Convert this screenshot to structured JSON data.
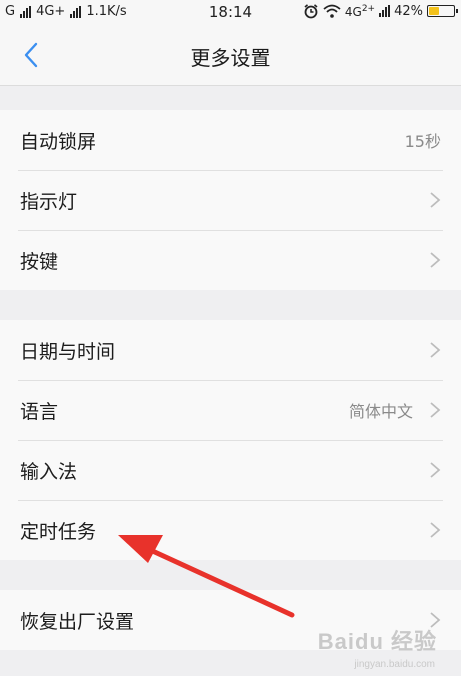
{
  "status_bar": {
    "carrier": "G",
    "network": "4G+",
    "speed": "1.1K/s",
    "time": "18:14",
    "network_right": "4G",
    "battery_percent": "42%",
    "battery_level": 0.42
  },
  "header": {
    "title": "更多设置",
    "back_icon": "chevron-left-icon"
  },
  "groups": [
    {
      "items": [
        {
          "label": "自动锁屏",
          "value": "15秒",
          "chevron": false
        },
        {
          "label": "指示灯",
          "value": "",
          "chevron": true
        },
        {
          "label": "按键",
          "value": "",
          "chevron": true
        }
      ]
    },
    {
      "items": [
        {
          "label": "日期与时间",
          "value": "",
          "chevron": true
        },
        {
          "label": "语言",
          "value": "简体中文",
          "chevron": true
        },
        {
          "label": "输入法",
          "value": "",
          "chevron": true
        },
        {
          "label": "定时任务",
          "value": "",
          "chevron": true
        }
      ]
    },
    {
      "items": [
        {
          "label": "恢复出厂设置",
          "value": "",
          "chevron": true
        }
      ]
    }
  ],
  "colors": {
    "accent": "#3b8ff0",
    "annotation_arrow": "#e8322b",
    "battery_fill": "#f3c21b"
  },
  "watermark": {
    "brand": "Baidu 经验",
    "sub": "jingyan.baidu.com"
  }
}
